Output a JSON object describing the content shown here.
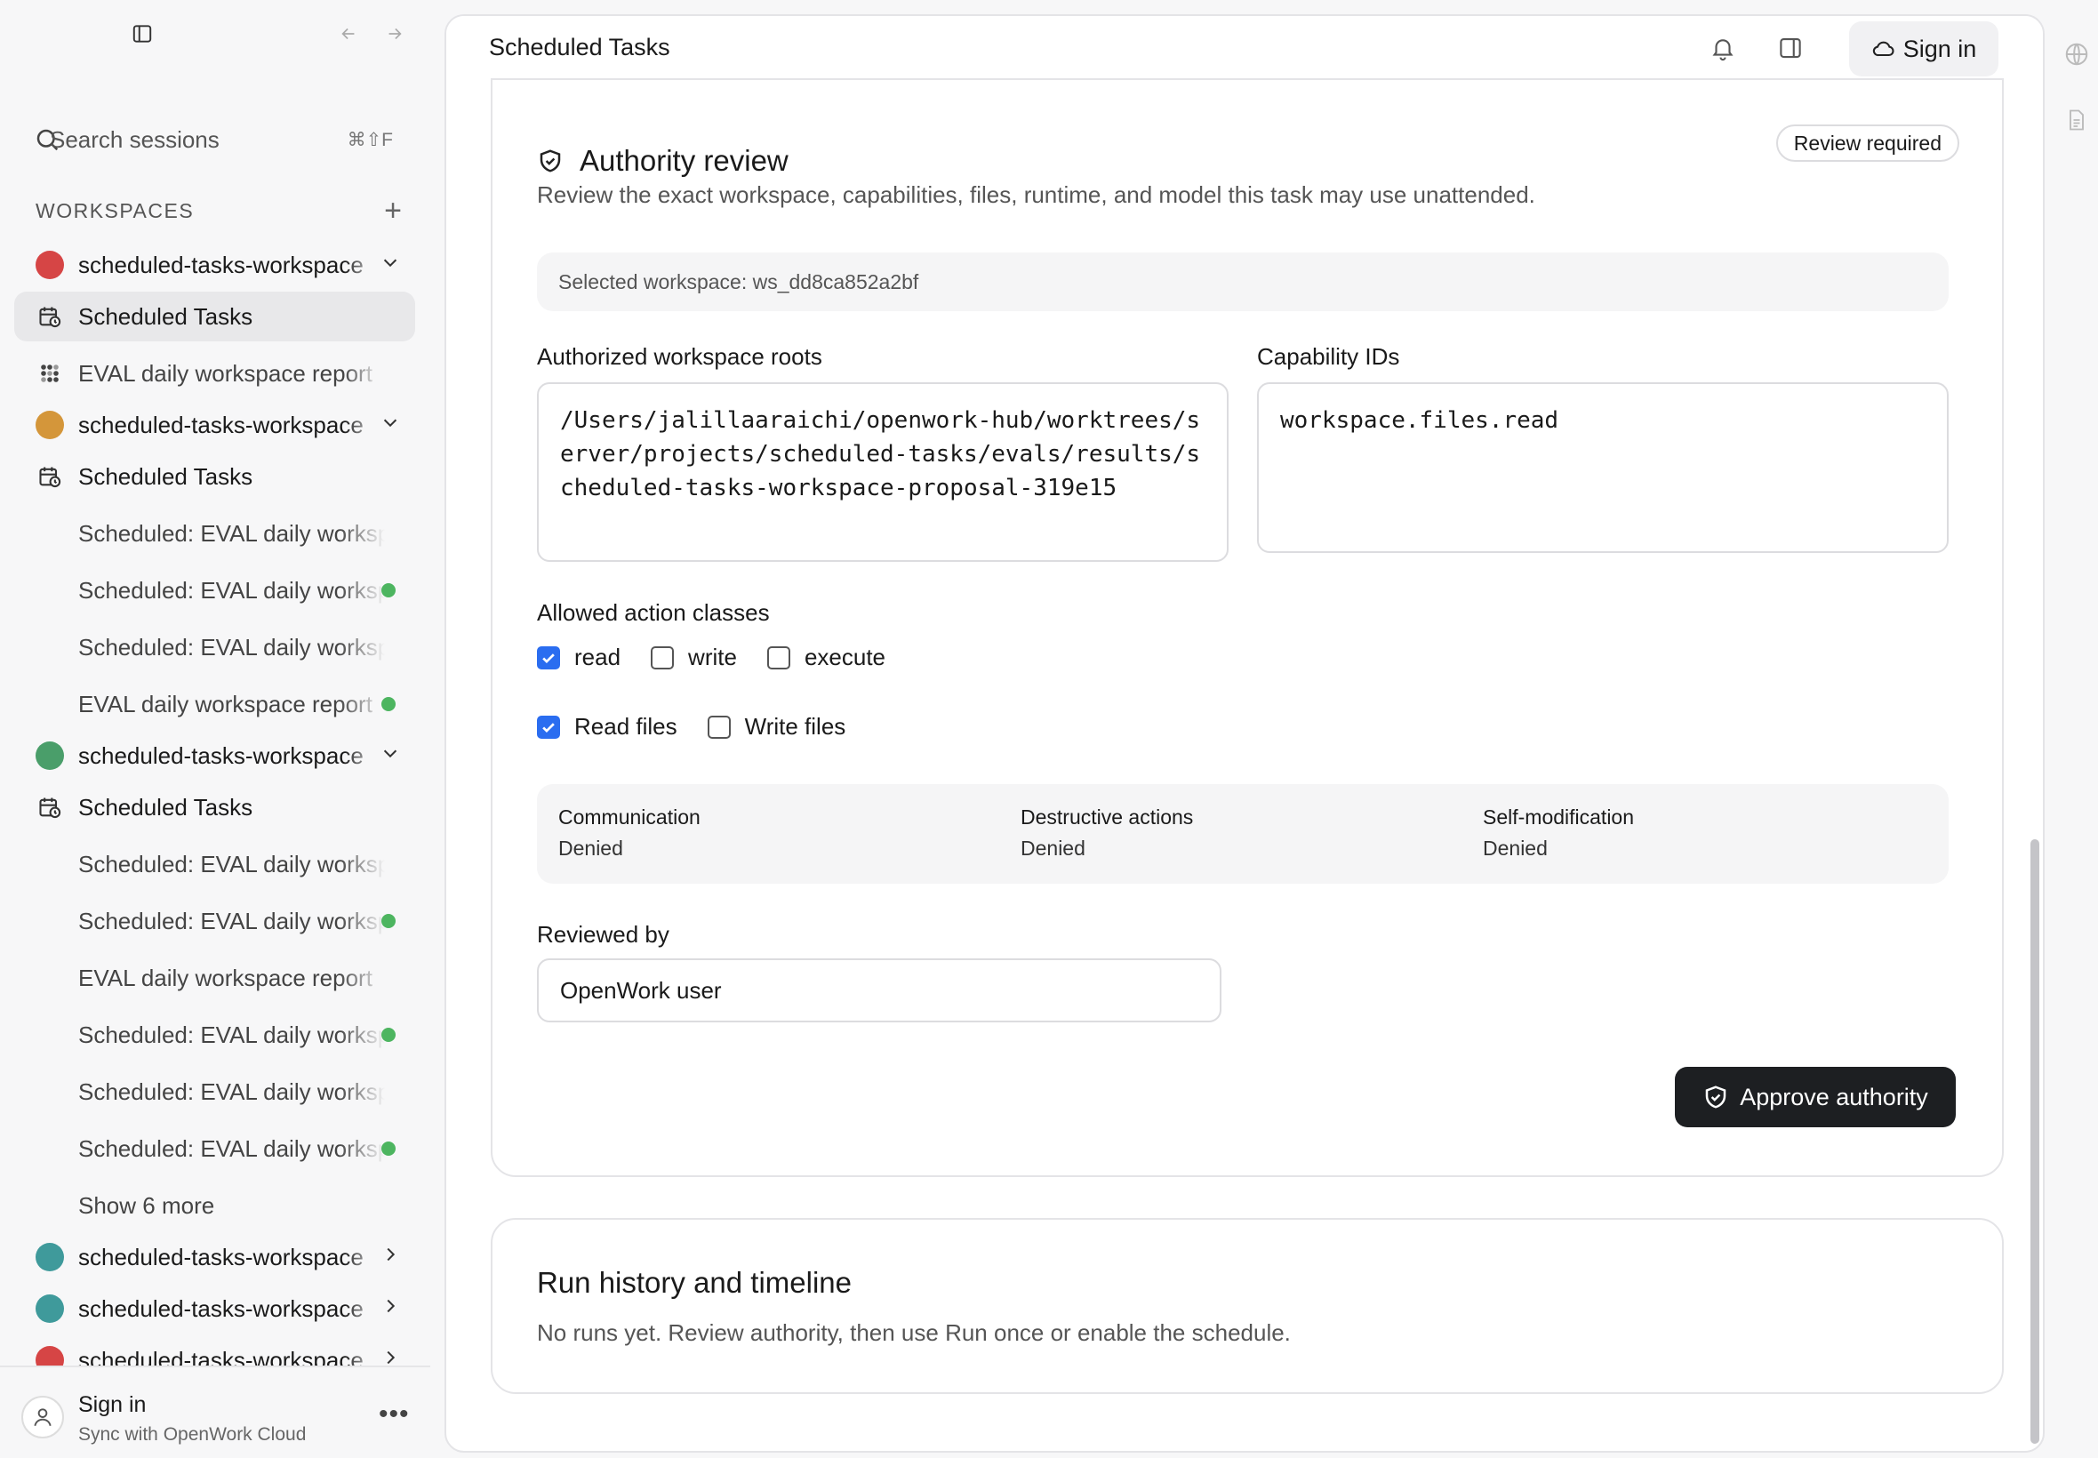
{
  "sidebar": {
    "search": {
      "label": "Search sessions",
      "shortcut": "⌘⇧F"
    },
    "workspaces_heading": "WORKSPACES",
    "items": [
      {
        "kind": "workspace",
        "label": "scheduled-tasks-workspace",
        "color": "#d64545",
        "expanded": true
      },
      {
        "kind": "task",
        "label": "Scheduled Tasks",
        "active": true
      },
      {
        "kind": "grid",
        "label": "EVAL daily workspace report"
      },
      {
        "kind": "workspace",
        "label": "scheduled-tasks-workspace",
        "color": "#d4963a",
        "expanded": true
      },
      {
        "kind": "task",
        "label": "Scheduled Tasks"
      },
      {
        "kind": "session",
        "label": "Scheduled: EVAL daily workspace",
        "status": false
      },
      {
        "kind": "session",
        "label": "Scheduled: EVAL daily workspace",
        "status": true
      },
      {
        "kind": "session",
        "label": "Scheduled: EVAL daily workspace",
        "status": false
      },
      {
        "kind": "session",
        "label": "EVAL daily workspace report",
        "status": true
      },
      {
        "kind": "workspace",
        "label": "scheduled-tasks-workspace",
        "color": "#4a9e6a",
        "expanded": true
      },
      {
        "kind": "task",
        "label": "Scheduled Tasks"
      },
      {
        "kind": "session",
        "label": "Scheduled: EVAL daily workspace",
        "status": false
      },
      {
        "kind": "session",
        "label": "Scheduled: EVAL daily workspace",
        "status": true
      },
      {
        "kind": "session",
        "label": "EVAL daily workspace report",
        "status": false
      },
      {
        "kind": "session",
        "label": "Scheduled: EVAL daily workspace",
        "status": true
      },
      {
        "kind": "session",
        "label": "Scheduled: EVAL daily workspace",
        "status": false
      },
      {
        "kind": "session",
        "label": "Scheduled: EVAL daily workspace",
        "status": true
      },
      {
        "kind": "more",
        "label": "Show 6 more"
      },
      {
        "kind": "workspace",
        "label": "scheduled-tasks-workspace",
        "color": "#3f9a9b",
        "expanded": false
      },
      {
        "kind": "workspace",
        "label": "scheduled-tasks-workspace",
        "color": "#3f9a9b",
        "expanded": false
      },
      {
        "kind": "workspace",
        "label": "scheduled-tasks-workspace",
        "color": "#d64545",
        "expanded": false
      }
    ],
    "footer": {
      "name": "Sign in",
      "subtitle": "Sync with OpenWork Cloud"
    }
  },
  "header": {
    "title": "Scheduled Tasks",
    "sign_in": "Sign in"
  },
  "authority": {
    "title": "Authority review",
    "badge": "Review required",
    "description": "Review the exact workspace, capabilities, files, runtime, and model this task may use unattended.",
    "selected_workspace": "Selected workspace: ws_dd8ca852a2bf",
    "roots_label": "Authorized workspace roots",
    "roots_value": "/Users/jalillaaraichi/openwork-hub/worktrees/server/projects/scheduled-tasks/evals/results/scheduled-tasks-workspace-proposal-319e15",
    "capability_label": "Capability IDs",
    "capability_value": "workspace.files.read",
    "action_classes_label": "Allowed action classes",
    "action_classes": [
      {
        "label": "read",
        "checked": true
      },
      {
        "label": "write",
        "checked": false
      },
      {
        "label": "execute",
        "checked": false
      }
    ],
    "file_perms": [
      {
        "label": "Read files",
        "checked": true
      },
      {
        "label": "Write files",
        "checked": false
      }
    ],
    "denied": [
      {
        "name": "Communication",
        "value": "Denied"
      },
      {
        "name": "Destructive actions",
        "value": "Denied"
      },
      {
        "name": "Self-modification",
        "value": "Denied"
      }
    ],
    "reviewed_by_label": "Reviewed by",
    "reviewed_by_value": "OpenWork user",
    "approve_label": "Approve authority"
  },
  "history": {
    "title": "Run history and timeline",
    "description": "No runs yet. Review authority, then use Run once or enable the schedule."
  },
  "colors": {
    "accent": "#2a6df0",
    "status_green": "#4db560",
    "dark_button": "#1d1f22"
  }
}
